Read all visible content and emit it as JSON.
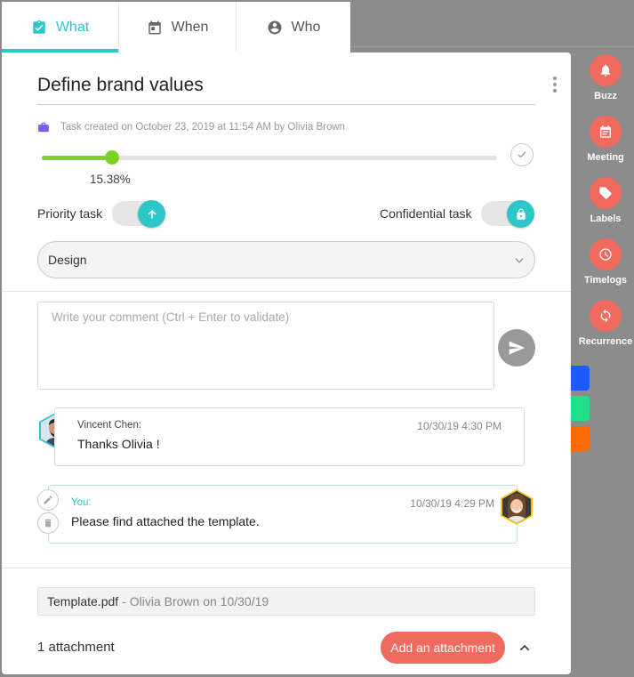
{
  "tabs": [
    {
      "label": "What",
      "icon": "clipboard-check-icon"
    },
    {
      "label": "When",
      "icon": "calendar-icon"
    },
    {
      "label": "Who",
      "icon": "account-circle-icon"
    }
  ],
  "task": {
    "title": "Define brand values",
    "meta": "Task created on October 23, 2019 at 11:54 AM by Olivia Brown",
    "progress_value": 15.38,
    "progress_label": "15.38%"
  },
  "toggles": {
    "priority_label": "Priority task",
    "confidential_label": "Confidential task"
  },
  "category": {
    "selected": "Design"
  },
  "comment_input": {
    "placeholder": "Write your comment (Ctrl + Enter to validate)"
  },
  "comments": [
    {
      "author": "Vincent Chen:",
      "time": "10/30/19 4:30 PM",
      "text": "Thanks Olivia !"
    },
    {
      "author": "You:",
      "time": "10/30/19 4:29 PM",
      "text": "Please find attached the template."
    }
  ],
  "attachment": {
    "name": "Template.pdf",
    "by": "- Olivia Brown on 10/30/19"
  },
  "footer": {
    "count": "1 attachment",
    "add_label": "Add an attachment"
  },
  "sidebar": [
    {
      "label": "Buzz",
      "icon": "bell-icon"
    },
    {
      "label": "Meeting",
      "icon": "calendar-icon"
    },
    {
      "label": "Labels",
      "icon": "tag-icon"
    },
    {
      "label": "Timelogs",
      "icon": "clock-icon"
    },
    {
      "label": "Recurrence",
      "icon": "refresh-icon"
    }
  ],
  "colors": {
    "accent": "#2ec7c9",
    "progress": "#7ed321",
    "action": "#f06a5e",
    "swatches": [
      "#1a5cff",
      "#1de088",
      "#ff6a00"
    ]
  }
}
